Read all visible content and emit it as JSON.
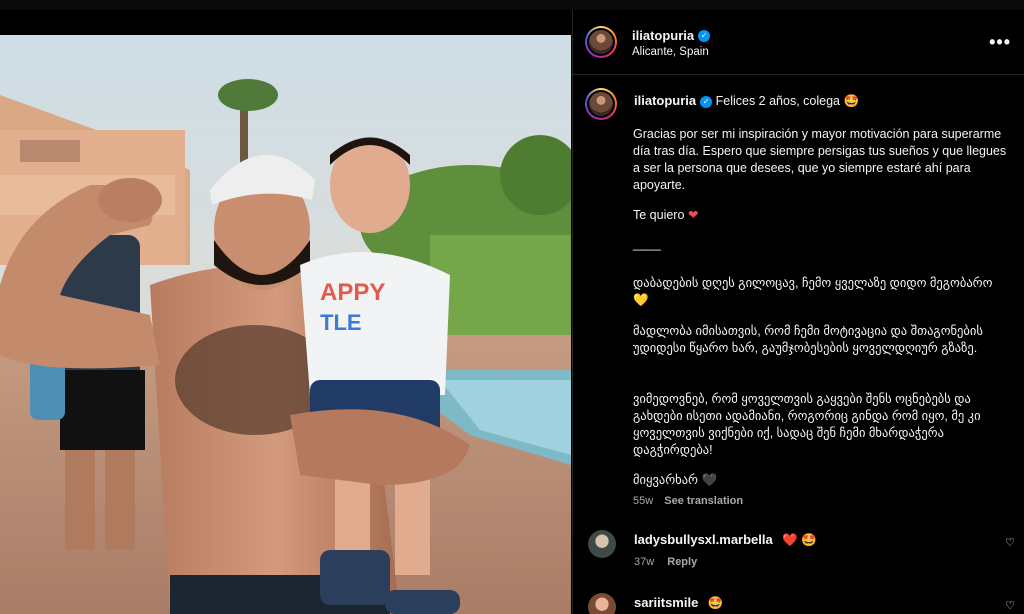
{
  "post": {
    "username": "iliatopuria",
    "location": "Alicante, Spain",
    "caption_title": "Felices 2 años, colega 🤩",
    "caption_es": "Gracias por ser mi inspiración y mayor motivación para superarme día tras día. Espero que siempre persigas tus sueños y que llegues a ser la persona que desees, que yo siempre estaré ahí para apoyarte.",
    "te_quiero": "Te quiero",
    "separator": "____",
    "ka_1": "დაბადების დღეს გილოცავ, ჩემო ყველაზე დიდო მეგობარო 💛",
    "ka_2": "მადლობა იმისათვის, რომ ჩემი მოტივაცია და შთაგონების უდიდესი წყარო ხარ, გაუმჯობესების ყოველდღიურ გზაზე.",
    "ka_3": "ვიმედოვნებ, რომ ყოველთვის გაყვები შენს ოცნებებს და გახდები ისეთი ადამიანი, როგორიც გინდა რომ იყო, მე კი ყოველთვის ვიქნები იქ, სადაც შენ ჩემი მხარდაჭერა დაგჭირდება!",
    "ka_4": "მიყვარხარ 🖤",
    "age": "55w",
    "see_translation": "See translation"
  },
  "comments": [
    {
      "username": "ladysbullysxl.marbella",
      "text": "❤️ 🤩",
      "age": "37w",
      "reply": "Reply"
    },
    {
      "username": "sariitsmile",
      "text": "🤩"
    }
  ],
  "icons": {
    "more": "more-options-icon",
    "verified": "verified-badge-icon",
    "like": "heart-icon"
  },
  "colors": {
    "background": "#000000",
    "verified": "#0095f6",
    "heart": "#ed4956"
  }
}
